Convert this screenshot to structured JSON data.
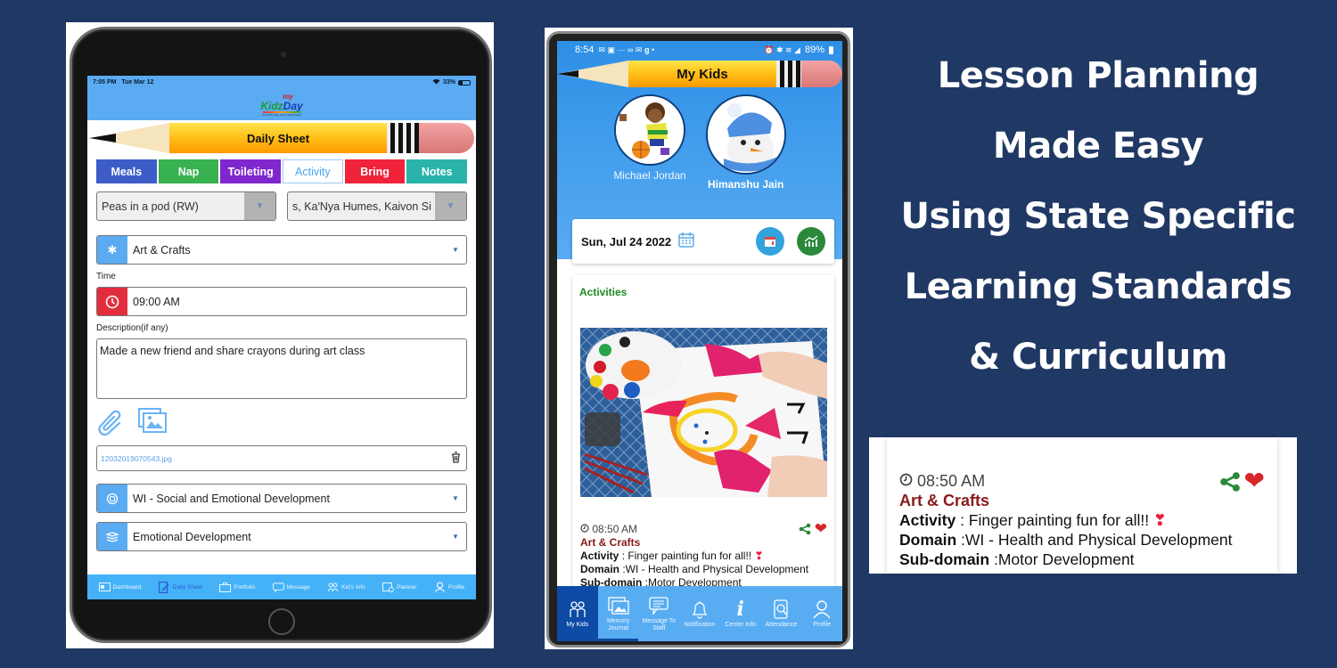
{
  "tablet": {
    "status": {
      "time": "7:05 PM",
      "date": "Tue Mar 12",
      "battery": "33%"
    },
    "logo": {
      "my": "my",
      "brand_k": "Kidz",
      "brand_d": "Day",
      "tagline": "Your kid's Day, Just a Click Away!"
    },
    "banner": "Daily Sheet",
    "tabs": [
      {
        "label": "Meals"
      },
      {
        "label": "Nap"
      },
      {
        "label": "Toileting"
      },
      {
        "label": "Activity"
      },
      {
        "label": "Bring"
      },
      {
        "label": "Notes"
      }
    ],
    "active_tab": "Activity",
    "classroom_select": "Peas in a pod (RW)",
    "children_select": "s, Ka'Nya Humes, Kaivon Si",
    "activity_type": "Art & Crafts",
    "time_label": "Time",
    "time_value": "09:00 AM",
    "description_label": "Description(if any)",
    "description_value": "Made a new friend and share crayons during art class",
    "attachment_file": "12032019070543.jpg",
    "domain_select": "WI - Social and Emotional Development",
    "subdomain_select": "Emotional Development",
    "nav": [
      {
        "label": "Dashboard",
        "icon": "dashboard-icon"
      },
      {
        "label": "Daily Sheet",
        "icon": "daily-sheet-icon"
      },
      {
        "label": "Portfolio",
        "icon": "briefcase-icon"
      },
      {
        "label": "Message",
        "icon": "message-icon"
      },
      {
        "label": "Kid's Info",
        "icon": "kids-icon"
      },
      {
        "label": "Planner",
        "icon": "planner-icon"
      },
      {
        "label": "Profile",
        "icon": "profile-icon"
      }
    ],
    "active_nav": "Daily Sheet",
    "colors": {
      "header": "#5aabf2",
      "meals": "#3d5cc8",
      "nap": "#38b150",
      "toileting": "#7f27cc",
      "bring": "#f0233b",
      "notes": "#2ab3aa"
    }
  },
  "phone": {
    "status": {
      "time": "8:54",
      "battery": "89%"
    },
    "banner": "My Kids",
    "kids": [
      {
        "name": "Michael Jordan",
        "selected": false
      },
      {
        "name": "Himanshu Jain",
        "selected": true
      }
    ],
    "date": "Sun, Jul 24 2022",
    "section_title": "Activities",
    "post": {
      "time": "08:50 AM",
      "category": "Art & Crafts",
      "activity_label": "Activity",
      "activity_value": " : Finger painting fun for all!! ",
      "domain_label": "Domain",
      "domain_value": " :WI - Health and Physical Development",
      "subdomain_label": "Sub-domain",
      "subdomain_value": " :Motor Development"
    },
    "nav": [
      {
        "label": "My Kids",
        "icon": "my-kids-icon"
      },
      {
        "label": "Memory Journal",
        "icon": "memory-journal-icon"
      },
      {
        "label": "Message To Staff",
        "icon": "message-icon"
      },
      {
        "label": "Notification",
        "icon": "bell-icon"
      },
      {
        "label": "Center Info",
        "icon": "info-icon"
      },
      {
        "label": "Attendance",
        "icon": "attendance-icon"
      },
      {
        "label": "Profile",
        "icon": "profile-icon"
      }
    ],
    "active_nav": "My Kids"
  },
  "headline": {
    "lines": [
      "Lesson Planning",
      "Made Easy",
      "Using State Specific",
      "Learning Standards",
      "& Curriculum"
    ]
  },
  "zoom_card": {
    "time": "08:50 AM",
    "category": "Art & Crafts",
    "activity_label": "Activity",
    "activity_value": " : Finger painting fun for all!! ",
    "domain_label": "Domain",
    "domain_value": " :WI - Health and Physical Development",
    "subdomain_label": "Sub-domain",
    "subdomain_value": " :Motor Development"
  },
  "background_color": "#203864"
}
